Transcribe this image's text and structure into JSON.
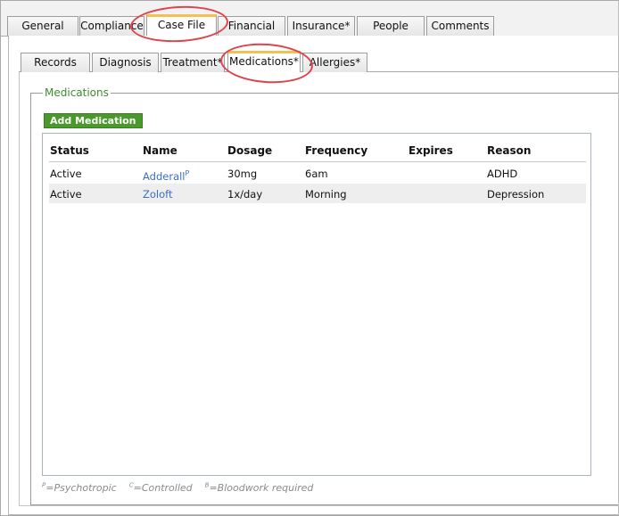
{
  "top_tabs": [
    {
      "label": "General",
      "active": false
    },
    {
      "label": "Compliance",
      "active": false
    },
    {
      "label": "Case File",
      "active": true
    },
    {
      "label": "Financial",
      "active": false
    },
    {
      "label": "Insurance*",
      "active": false
    },
    {
      "label": "People",
      "active": false
    },
    {
      "label": "Comments",
      "active": false
    }
  ],
  "sub_tabs": [
    {
      "label": "Records",
      "active": false
    },
    {
      "label": "Diagnosis",
      "active": false
    },
    {
      "label": "Treatment*",
      "active": false
    },
    {
      "label": "Medications*",
      "active": true
    },
    {
      "label": "Allergies*",
      "active": false
    }
  ],
  "section": {
    "legend": "Medications",
    "add_button": "Add Medication"
  },
  "table": {
    "columns": [
      "Status",
      "Name",
      "Dosage",
      "Frequency",
      "Expires",
      "Reason"
    ],
    "rows": [
      {
        "status": "Active",
        "name": "Adderall",
        "name_sup": "P",
        "dosage": "30mg",
        "frequency": "6am",
        "expires": "",
        "reason": "ADHD"
      },
      {
        "status": "Active",
        "name": "Zoloft",
        "name_sup": "",
        "dosage": "1x/day",
        "frequency": "Morning",
        "expires": "",
        "reason": "Depression"
      }
    ]
  },
  "legend_notes": [
    {
      "sup": "P",
      "text": "=Psychotropic"
    },
    {
      "sup": "C",
      "text": "=Controlled"
    },
    {
      "sup": "B",
      "text": "=Bloodwork required"
    }
  ],
  "colors": {
    "accent_tab": "#f4c04f",
    "add_button": "#4a9a2b",
    "legend_text": "#3d8b2f",
    "link": "#3b6fc4",
    "annotation": "#e0424c"
  }
}
